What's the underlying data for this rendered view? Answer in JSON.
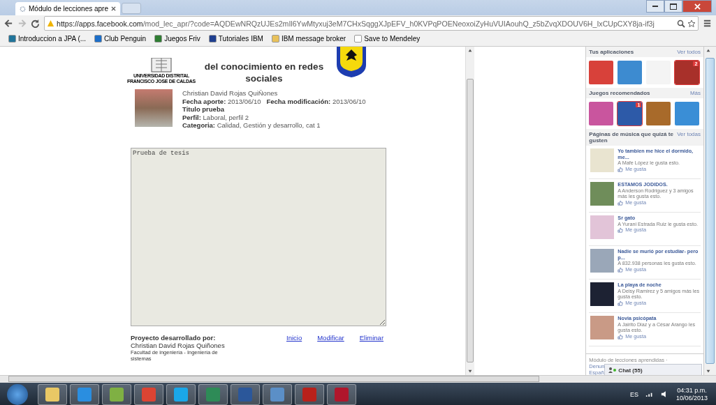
{
  "browser": {
    "tab_title": "Módulo de lecciones apre",
    "url_host": "https://apps.facebook.com",
    "url_path": "/mod_lec_apr/?code=AQDEwNRQzUJEs2mIl6YwMtyxuj3eM7CHxSqggXJpEFV_h0KVPqPOENeoxoiZyHuVUIAouhQ_z5bZvqXDOUV6H_IxCUpCXY8ja-if3j",
    "bookmarks": [
      {
        "label": "Introduccion a JPA (...",
        "kind": "wordpress"
      },
      {
        "label": "Club Penguin",
        "kind": "penguin"
      },
      {
        "label": "Juegos Friv",
        "kind": "friv"
      },
      {
        "label": "Tutoriales IBM",
        "kind": "ibm"
      },
      {
        "label": "IBM message broker",
        "kind": "folder"
      },
      {
        "label": "Save to Mendeley",
        "kind": "page"
      }
    ]
  },
  "content": {
    "logo_lines": [
      "UNIVERSIDAD DISTRITAL",
      "FRANCISCO JOSE DE CALDAS"
    ],
    "title": "del conocimiento en redes sociales",
    "record": {
      "author": "Christian David Rojas QuiÑones",
      "created_label": "Fecha aporte:",
      "created": "2013/06/10",
      "modified_label": "Fecha modificación:",
      "modified": "2013/06/10",
      "title": "Titulo prueba",
      "profile_label": "Perfil:",
      "profile": "Laboral, perfil 2",
      "category_label": "Categoria:",
      "category": "Calidad, Gestión y desarrollo, cat 1"
    },
    "textarea": {
      "value": "Prueba de tesis"
    },
    "footer": {
      "label": "Proyecto desarrollado por:",
      "name": "Christian David Rojas Quiñones",
      "faculty": "Facultad de ingeniería - Ingeniería de sistemas"
    },
    "links": [
      "Inicio",
      "Modificar",
      "Eliminar"
    ]
  },
  "sidebar": {
    "apps": {
      "title": "Tus aplicaciones",
      "link": "Ver todos",
      "items": [
        {
          "notification": false
        },
        {
          "notification": false
        },
        {
          "notification": false
        },
        {
          "notification": true,
          "badge": "2"
        }
      ]
    },
    "games": {
      "title": "Juegos recomendados",
      "link": "Más",
      "items": [
        {
          "notification": false
        },
        {
          "notification": true,
          "badge": "1"
        },
        {
          "notification": false
        },
        {
          "notification": false
        }
      ]
    },
    "music": {
      "title": "Páginas de música que quizá te gusten",
      "link": "Ver todas",
      "pages": [
        {
          "name": "Yo tambien me hice el dormido, me...",
          "likes": "A Mafe López le gusta esto.",
          "action": "Me gusta"
        },
        {
          "name": "ESTAMOS JODIDOS.",
          "likes": "A Anderson Rodriguez y 3 amigos más les gusta esto.",
          "action": "Me gusta"
        },
        {
          "name": "Sr gato",
          "likes": "A Yurani Estrada Ruiz le gusta esto.",
          "action": "Me gusta"
        },
        {
          "name": "Nadie se murió por estudiar- pero p...",
          "likes": "A 832.938 personas les gusta esto.",
          "action": "Me gusta"
        },
        {
          "name": "La playa de noche",
          "likes": "A Deisy Ramirez y 5 amigos más les gusta esto.",
          "action": "Me gusta"
        },
        {
          "name": "Novia psicópata",
          "likes": "A Jairito Diaz y a César Arango les gusta esto.",
          "action": "Me gusta"
        }
      ]
    },
    "footer_lines": [
      "Módulo de lecciones aprendidas ·",
      "Denun",
      "Españ"
    ],
    "chat": "Chat (55)"
  },
  "taskbar": {
    "language": "ES",
    "time": "04:31 p.m.",
    "date": "10/06/2013"
  }
}
